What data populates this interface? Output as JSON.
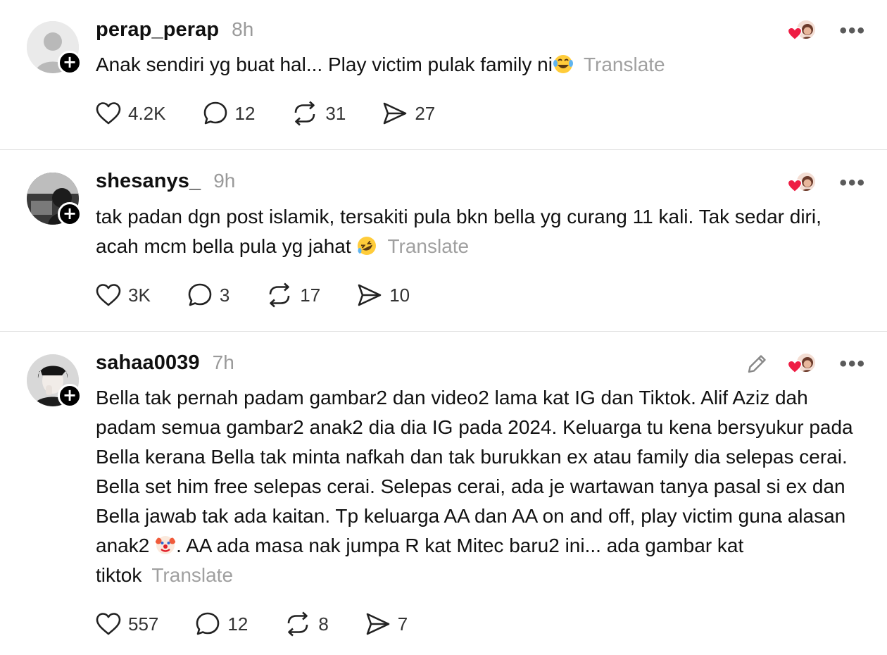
{
  "posts": [
    {
      "username": "perap_perap",
      "time": "8h",
      "text": "Anak sendiri yg buat hal... Play victim pulak family ni",
      "emoji": "face-with-tears-of-joy",
      "text_after": "",
      "translate": "Translate",
      "likes": "4.2K",
      "replies": "12",
      "reposts": "31",
      "shares": "27"
    },
    {
      "username": "shesanys_",
      "time": "9h",
      "text": "tak padan dgn post islamik, tersakiti pula bkn bella yg curang 11 kali. Tak sedar diri, acah mcm bella pula yg jahat ",
      "emoji": "rolling-on-floor-laughing",
      "text_after": "",
      "translate": "Translate",
      "likes": "3K",
      "replies": "3",
      "reposts": "17",
      "shares": "10"
    },
    {
      "username": "sahaa0039",
      "time": "7h",
      "text": "Bella tak pernah padam gambar2 dan video2 lama kat IG dan Tiktok. Alif Aziz dah padam semua gambar2 anak2 dia dia IG pada 2024. Keluarga tu kena bersyukur pada Bella kerana Bella tak minta nafkah dan tak burukkan ex atau family dia selepas cerai. Bella set him free selepas cerai. Selepas cerai, ada je wartawan tanya pasal si ex dan Bella jawab tak ada kaitan. Tp keluarga AA dan AA on and off, play victim guna alasan anak2 ",
      "emoji": "clown-face",
      "text_after": ". AA ada masa nak jumpa R kat Mitec baru2 ini... ada gambar kat tiktok",
      "translate": "Translate",
      "likes": "557",
      "replies": "12",
      "reposts": "8",
      "shares": "7"
    }
  ],
  "colors": {
    "text": "#101010",
    "muted": "#9a9a9a",
    "divider": "#e2e2e2",
    "heart": "#ee1d44"
  }
}
